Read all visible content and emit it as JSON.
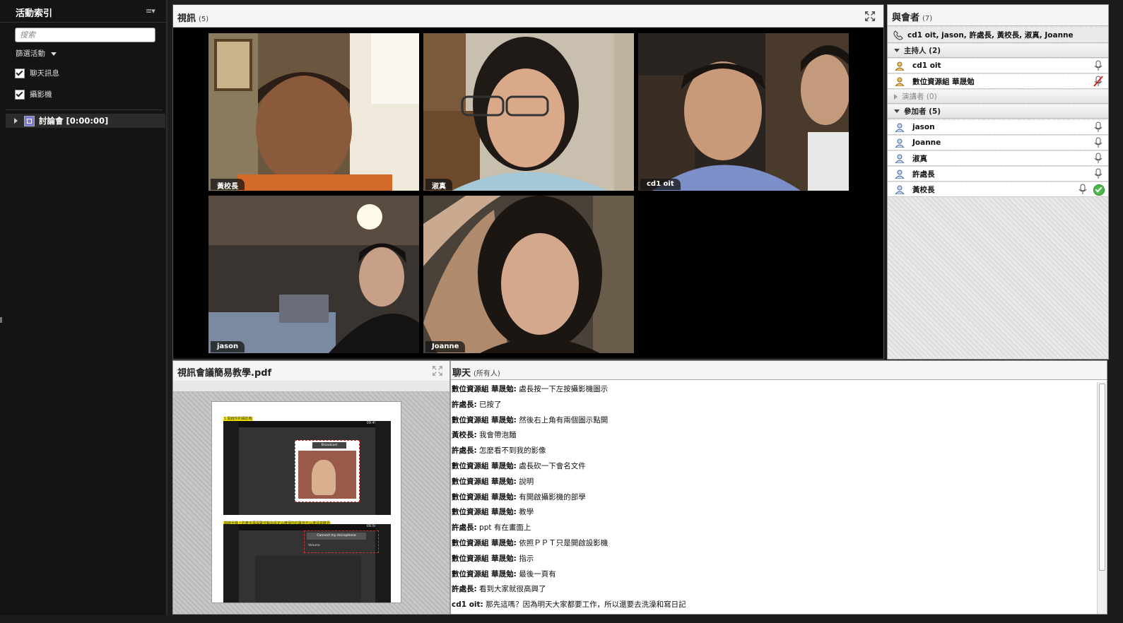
{
  "sidebar": {
    "title": "活動索引",
    "menu_icon": "≡▾",
    "search_placeholder": "搜索",
    "filter_label": "篩選活動",
    "checkboxes": [
      {
        "label": "聊天訊息",
        "checked": true
      },
      {
        "label": "攝影機",
        "checked": true
      }
    ],
    "tree_item": "討論會 [0:00:00]"
  },
  "video": {
    "title": "視訊",
    "count": "(5)",
    "tiles": [
      {
        "name": "黃校長"
      },
      {
        "name": "淑真"
      },
      {
        "name": "cd1 oit"
      },
      {
        "name": "jason"
      },
      {
        "name": "Joanne"
      }
    ]
  },
  "attendees": {
    "title": "與會者",
    "count": "(7)",
    "status_line": "cd1 oit, jason, 許處長, 黃校長, 淑真, Joanne",
    "groups": {
      "hosts": "主持人 (2)",
      "presenters": "演講者 (0)",
      "participants": "參加者 (5)"
    },
    "hosts": [
      {
        "name": "cd1 oit",
        "mic": "on"
      },
      {
        "name": "數位資源組 華晟勉",
        "mic": "muted"
      }
    ],
    "participants": [
      {
        "name": "jason",
        "mic": "on"
      },
      {
        "name": "Joanne",
        "mic": "on"
      },
      {
        "name": "淑真",
        "mic": "on"
      },
      {
        "name": "許處長",
        "mic": "on"
      },
      {
        "name": "黃校長",
        "mic": "on",
        "status": "check"
      }
    ]
  },
  "presentation": {
    "title": "視訊會議簡易教學.pdf",
    "slide_caption_1": "1.開啟你的攝影機",
    "slide_caption_2": "開啟手機上的麥克風與聲音輸出設定以確保你的聲音可以被清楚聽見",
    "slide_btn_1": "Broadcast",
    "slide_btn_2": "Connect my microphone",
    "slide_volume": "Volume",
    "time_1": "09:49",
    "time_2": "09:50"
  },
  "chat": {
    "title": "聊天",
    "scope": "(所有人)",
    "messages": [
      {
        "who": "數位資源組 華晟勉:",
        "text": "處長按一下左按攝影機圖示"
      },
      {
        "who": "許處長:",
        "text": "已按了"
      },
      {
        "who": "數位資源組 華晟勉:",
        "text": "然後右上角有兩個圖示點開"
      },
      {
        "who": "黃校長:",
        "text": "我會帶泡麵"
      },
      {
        "who": "許處長:",
        "text": "怎麼看不到我的影像"
      },
      {
        "who": "數位資源組 華晟勉:",
        "text": "處長砍一下會名文件"
      },
      {
        "who": "數位資源組 華晟勉:",
        "text": "說明"
      },
      {
        "who": "數位資源組 華晟勉:",
        "text": "有開啟攝影機的部學"
      },
      {
        "who": "數位資源組 華晟勉:",
        "text": "教學"
      },
      {
        "who": "許處長:",
        "text": "ppt 有在畫面上"
      },
      {
        "who": "數位資源組 華晟勉:",
        "text": "依照ＰＰＴ只是開啟設影機"
      },
      {
        "who": "數位資源組 華晟勉:",
        "text": "指示"
      },
      {
        "who": "數位資源組 華晟勉:",
        "text": "最後一頁有"
      },
      {
        "who": "許處長:",
        "text": "看到大家就很高興了"
      },
      {
        "who": "cd1 oit:",
        "text": "那先這嗎？因為明天大家都要工作，所以還要去洗澡和寫日記"
      }
    ]
  },
  "colors": {
    "app_bg": "#1c1c1c",
    "panel_header": "#f4f4f4",
    "ok_green": "#4cb848",
    "muted_red": "#d02020"
  }
}
